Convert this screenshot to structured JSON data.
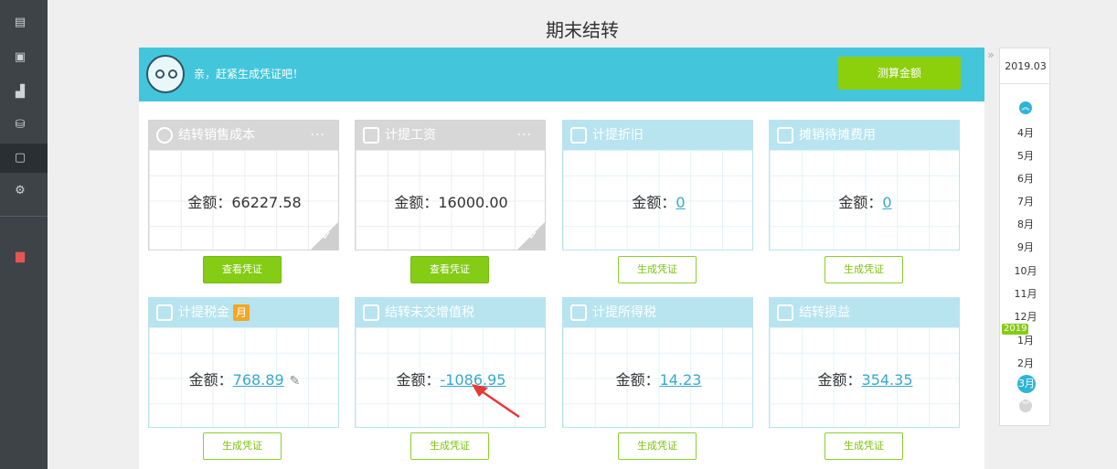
{
  "page": {
    "title": "期末结转"
  },
  "banner": {
    "message": "亲，赶紧生成凭证吧！",
    "calc_button": "测算金额"
  },
  "amount_label": "金额：",
  "cards": [
    {
      "title": "结转销售成本",
      "amount": "66227.58",
      "button": "查看凭证",
      "status": "done"
    },
    {
      "title": "计提工资",
      "amount": "16000.00",
      "button": "查看凭证",
      "status": "done"
    },
    {
      "title": "计提折旧",
      "amount": "0",
      "button": "生成凭证",
      "status": "pending"
    },
    {
      "title": "摊销待摊费用",
      "amount": "0",
      "button": "生成凭证",
      "status": "pending"
    },
    {
      "title": "计提税金",
      "badge": "月",
      "amount": "768.89",
      "button": "生成凭证",
      "status": "pending"
    },
    {
      "title": "结转未交增值税",
      "amount": "-1086.95",
      "button": "生成凭证",
      "status": "pending"
    },
    {
      "title": "计提所得税",
      "amount": "14.23",
      "button": "生成凭证",
      "status": "pending"
    },
    {
      "title": "结转损益",
      "amount": "354.35",
      "button": "生成凭证",
      "status": "pending"
    }
  ],
  "period_panel": {
    "current": "2019.03",
    "months": [
      "4月",
      "5月",
      "6月",
      "7月",
      "8月",
      "9月",
      "10月",
      "11月",
      "12月",
      "1月",
      "2月"
    ],
    "year_tag": "2019",
    "selected": "3月"
  },
  "icons": {
    "sidebar": [
      "ledger-icon",
      "voucher-icon",
      "chart-icon",
      "money-icon",
      "closing-icon",
      "settings-icon",
      "gift-icon"
    ]
  },
  "colors": {
    "accent": "#43c6dc",
    "green": "#84cc16",
    "link": "#39a9c9"
  }
}
